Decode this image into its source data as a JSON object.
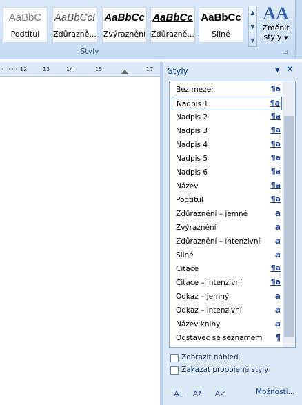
{
  "ribbon": {
    "gallery": [
      {
        "sample": "AaBbC",
        "label": "Podtitul"
      },
      {
        "sample": "AaBbCcI",
        "label": "Zdůrazně..."
      },
      {
        "sample": "AaBbCc",
        "label": "Zvýraznění"
      },
      {
        "sample": "AaBbCc",
        "label": "Zdůrazně..."
      },
      {
        "sample": "AaBbCc",
        "label": "Silné"
      }
    ],
    "group_label": "Styly",
    "change_styles": {
      "icon": "AA",
      "label1": "Změnit",
      "label2": "styly"
    }
  },
  "ruler": {
    "ticks": [
      "12",
      "13",
      "14",
      "15",
      "17"
    ]
  },
  "pane": {
    "title": "Styly",
    "styles": [
      {
        "name": "Bez mezer",
        "kind": "¶a"
      },
      {
        "name": "Nadpis 1",
        "kind": "¶a"
      },
      {
        "name": "Nadpis 2",
        "kind": "¶a"
      },
      {
        "name": "Nadpis 3",
        "kind": "¶a"
      },
      {
        "name": "Nadpis 4",
        "kind": "¶a"
      },
      {
        "name": "Nadpis 5",
        "kind": "¶a"
      },
      {
        "name": "Nadpis 6",
        "kind": "¶a"
      },
      {
        "name": "Název",
        "kind": "¶a"
      },
      {
        "name": "Podtitul",
        "kind": "¶a"
      },
      {
        "name": "Zdůraznění – jemné",
        "kind": "a"
      },
      {
        "name": "Zvýraznění",
        "kind": "a"
      },
      {
        "name": "Zdůraznění – intenzivní",
        "kind": "a"
      },
      {
        "name": "Silné",
        "kind": "a"
      },
      {
        "name": "Citace",
        "kind": "¶a"
      },
      {
        "name": "Citace – intenzivní",
        "kind": "¶a"
      },
      {
        "name": "Odkaz – jemný",
        "kind": "a"
      },
      {
        "name": "Odkaz – intenzivní",
        "kind": "a"
      },
      {
        "name": "Název knihy",
        "kind": "a"
      },
      {
        "name": "Odstavec se seznamem",
        "kind": "¶"
      }
    ],
    "selected_index": 1,
    "show_preview": {
      "label": "Zobrazit náhled",
      "checked": false
    },
    "disable_linked": {
      "label": "Zakázat propojené styly",
      "checked": false
    },
    "options_link": "Možnosti..."
  },
  "colors": {
    "accent": "#15428b",
    "ribbon_bg": "#dbe8f7"
  }
}
